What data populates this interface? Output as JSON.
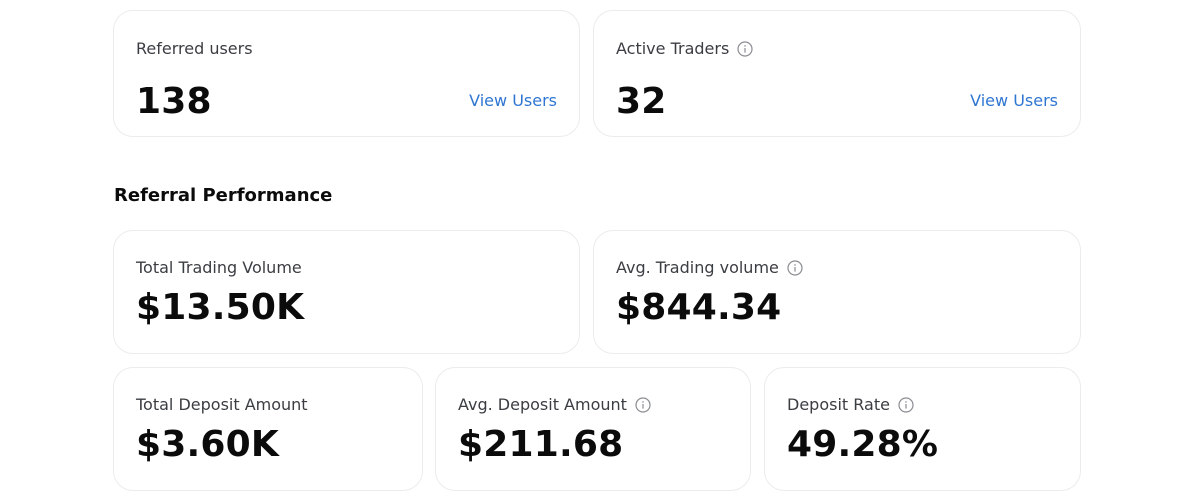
{
  "colors": {
    "link": "#2f76d2",
    "card_border": "#ececee",
    "label_text": "#3a3d42",
    "value_text": "#0b0b0c"
  },
  "referral_summary": {
    "referred_users": {
      "label": "Referred users",
      "value": "138",
      "link_label": "View Users"
    },
    "active_traders": {
      "label": "Active Traders",
      "value": "32",
      "link_label": "View Users",
      "icon": "info-icon"
    }
  },
  "referral_performance": {
    "title": "Referral Performance",
    "total_trading_volume": {
      "label": "Total Trading Volume",
      "value": "$13.50K"
    },
    "avg_trading_volume": {
      "label": "Avg. Trading volume",
      "value": "$844.34",
      "icon": "info-icon"
    },
    "total_deposit_amount": {
      "label": "Total Deposit Amount",
      "value": "$3.60K"
    },
    "avg_deposit_amount": {
      "label": "Avg. Deposit Amount",
      "value": "$211.68",
      "icon": "info-icon"
    },
    "deposit_rate": {
      "label": "Deposit Rate",
      "value": "49.28%",
      "icon": "info-icon"
    }
  }
}
